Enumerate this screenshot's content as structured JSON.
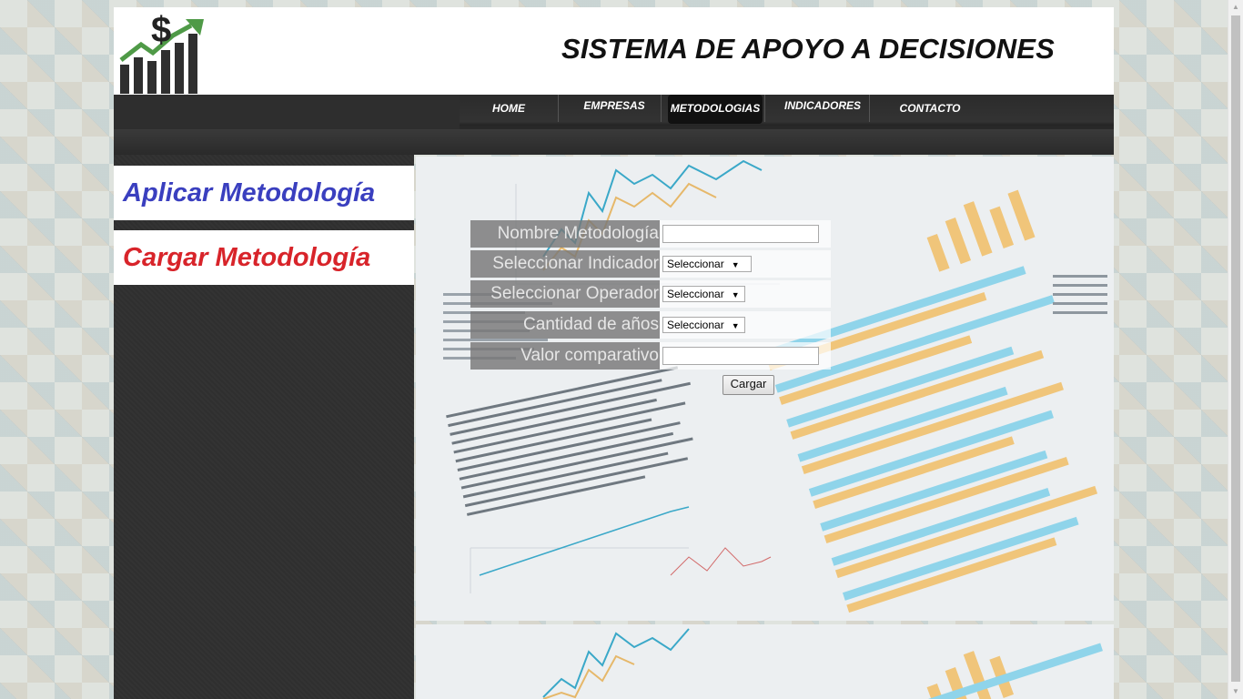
{
  "header": {
    "title": "SISTEMA DE APOYO A DECISIONES",
    "logo_icon": "dollar-growth-chart-icon"
  },
  "nav": {
    "items": [
      {
        "label": "HOME"
      },
      {
        "label": "EMPRESAS"
      },
      {
        "label": "METODOLOGIAS",
        "active": true
      },
      {
        "label": "INDICADORES"
      },
      {
        "label": "CONTACTO"
      }
    ]
  },
  "sidebar": {
    "apply_label": "Aplicar Metodología",
    "load_label": "Cargar Metodología"
  },
  "form": {
    "name_label": "Nombre Metodología",
    "name_value": "",
    "indicator_label": "Seleccionar Indicador",
    "indicator_value": "Seleccionar",
    "operator_label": "Seleccionar Operador",
    "operator_value": "Seleccionar",
    "years_label": "Cantidad de años",
    "years_value": "Seleccionar",
    "compare_label": "Valor comparativo",
    "compare_value": "",
    "submit_label": "Cargar"
  },
  "colors": {
    "apply": "#3a3fbf",
    "load": "#d8242a",
    "nav_bg": "#2e2e2e"
  }
}
